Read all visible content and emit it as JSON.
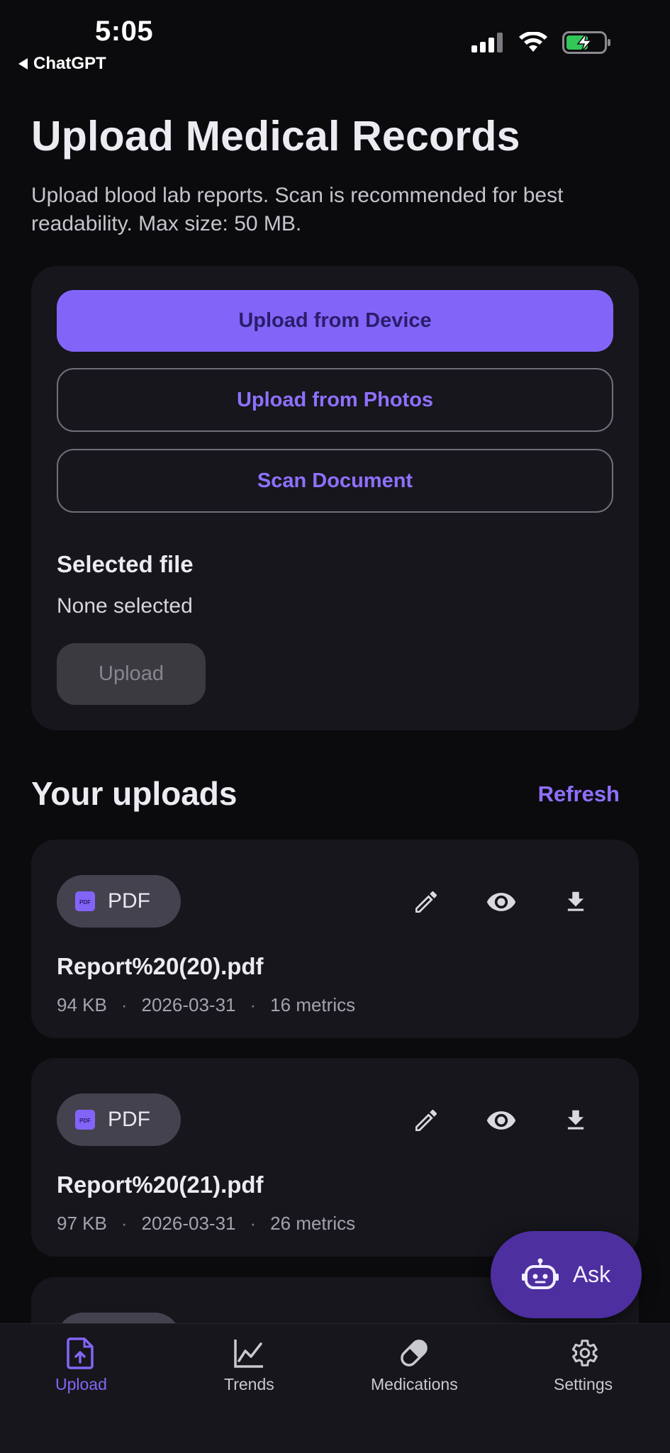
{
  "status_bar": {
    "time": "5:05",
    "back_app": "ChatGPT"
  },
  "header": {
    "title": "Upload Medical Records",
    "subtitle": "Upload blood lab reports. Scan is recommended for best readability. Max size: 50 MB."
  },
  "upload_card": {
    "upload_device_label": "Upload from Device",
    "upload_photos_label": "Upload from Photos",
    "scan_document_label": "Scan Document",
    "selected_file_label": "Selected file",
    "selected_file_value": "None selected",
    "upload_button_label": "Upload"
  },
  "uploads": {
    "title": "Your uploads",
    "refresh_label": "Refresh",
    "items": [
      {
        "type_label": "PDF",
        "icon_text": "PDF",
        "name": "Report%20(20).pdf",
        "size": "94 KB",
        "date": "2026-03-31",
        "metrics": "16 metrics"
      },
      {
        "type_label": "PDF",
        "icon_text": "PDF",
        "name": "Report%20(21).pdf",
        "size": "97 KB",
        "date": "2026-03-31",
        "metrics": "26 metrics"
      }
    ]
  },
  "fab": {
    "label": "Ask",
    "icon": "robot-icon"
  },
  "tabs": [
    {
      "label": "Upload",
      "icon": "upload-file-icon",
      "active": true
    },
    {
      "label": "Trends",
      "icon": "chart-line-icon",
      "active": false
    },
    {
      "label": "Medications",
      "icon": "pill-icon",
      "active": false
    },
    {
      "label": "Settings",
      "icon": "gear-icon",
      "active": false
    }
  ],
  "colors": {
    "background": "#0b0b0e",
    "card": "#16161c",
    "accent": "#8265f8",
    "accent_text": "#8f70ff",
    "fab": "#4d2fa0"
  }
}
